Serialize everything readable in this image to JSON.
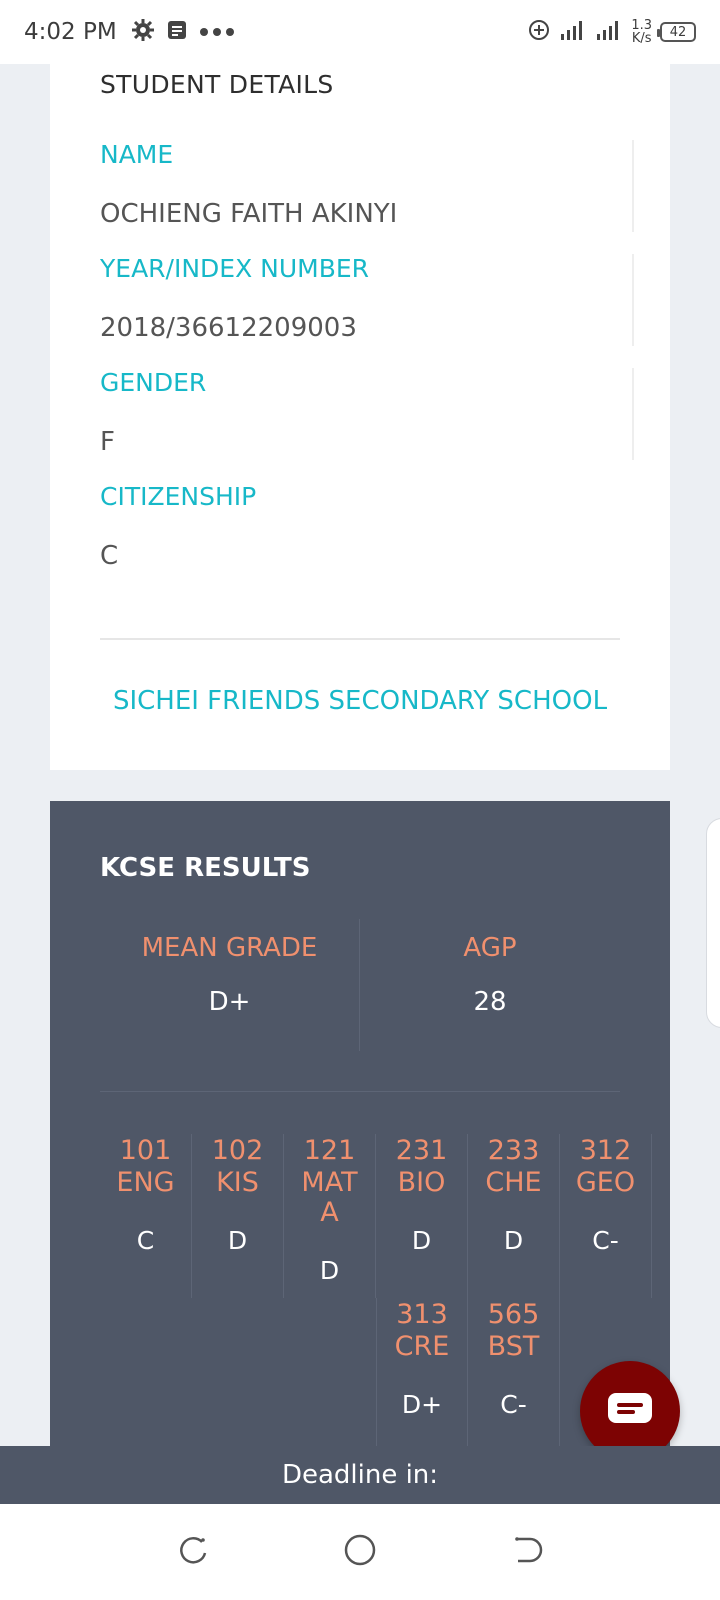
{
  "status_bar": {
    "time": "4:02 PM",
    "speed_value": "1.3",
    "speed_unit": "K/s",
    "battery": "42",
    "icons": [
      "gear-icon",
      "message-icon",
      "more-dots-icon",
      "data-saver-icon",
      "signal-icon",
      "signal-icon-2"
    ]
  },
  "student": {
    "section_title": "STUDENT DETAILS",
    "fields": [
      {
        "label": "NAME",
        "value": "OCHIENG FAITH AKINYI"
      },
      {
        "label": "YEAR/INDEX NUMBER",
        "value": "2018/36612209003"
      },
      {
        "label": "GENDER",
        "value": "F"
      },
      {
        "label": "CITIZENSHIP",
        "value": "C"
      }
    ],
    "school": "SICHEI FRIENDS SECONDARY SCHOOL"
  },
  "kcse": {
    "title": "KCSE RESULTS",
    "mean_grade_label": "MEAN GRADE",
    "mean_grade": "D+",
    "agp_label": "AGP",
    "agp": "28",
    "subjects": [
      {
        "code": "101",
        "name": "ENG",
        "grade": "C"
      },
      {
        "code": "102",
        "name": "KIS",
        "grade": "D"
      },
      {
        "code": "121",
        "name": "MATA",
        "name_display": "MAT\nA",
        "grade": "D"
      },
      {
        "code": "231",
        "name": "BIO",
        "grade": "D"
      },
      {
        "code": "233",
        "name": "CHE",
        "grade": "D"
      },
      {
        "code": "312",
        "name": "GEO",
        "grade": "C-"
      },
      {
        "code": "313",
        "name": "CRE",
        "grade": "D+"
      },
      {
        "code": "565",
        "name": "BST",
        "grade": "C-"
      }
    ]
  },
  "deadline": {
    "label": "Deadline in:"
  },
  "colors": {
    "accent_teal": "#17b8c8",
    "accent_orange": "#f0906e",
    "dark_panel": "#4f5767",
    "chat_button": "#7d0303"
  }
}
